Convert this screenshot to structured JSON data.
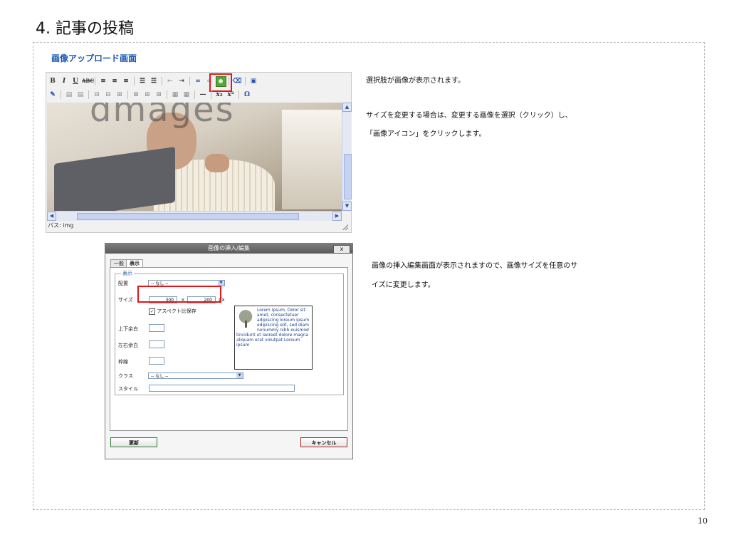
{
  "slide": {
    "title": "4. 記事の投稿",
    "section_heading": "画像アップロード画面",
    "page_number": "10"
  },
  "editor": {
    "toolbar_row1": [
      "B",
      "I",
      "U",
      "ABC"
    ],
    "toolbar_row2_right": [
      "x₂",
      "x²",
      "Ω"
    ],
    "watermark": "dmages",
    "path_label": "パス: img",
    "highlighted_tool": "image-icon"
  },
  "notes": {
    "line1": "選択肢が画像が表示されます。",
    "line2": "サイズを変更する場合は、変更する画像を選択（クリック）し、",
    "line3": "「画像アイコン」をクリックします。",
    "line4": "画像の挿入編集画面が表示されますので、画像サイズを任意のサ",
    "line5": "イズに変更します。"
  },
  "dialog": {
    "title": "画像の挿入/編集",
    "close_label": "x",
    "tabs": [
      "一般",
      "表示"
    ],
    "legend": "表示",
    "align_label": "配置",
    "align_value": "-- なし --",
    "size_label": "サイズ",
    "width_value": "300",
    "times": "×",
    "height_value": "200",
    "unit": "px",
    "keep_ratio_label": "アスペクト比保存",
    "vspace_label": "上下余白",
    "hspace_label": "左右余白",
    "border_label": "枠線",
    "class_label": "クラス",
    "class_value": "-- なし --",
    "style_label": "スタイル",
    "preview_text": "Lorem ipsum, Dolor sit amet, consectetuer adipiscing loreum ipsum edipiscing elit, sed diam nonummy nibh euismod tincidunt ut laoreet dolore magna aliquam erat volutpat.Loreum ipsum",
    "update_label": "更新",
    "cancel_label": "キャンセル"
  }
}
